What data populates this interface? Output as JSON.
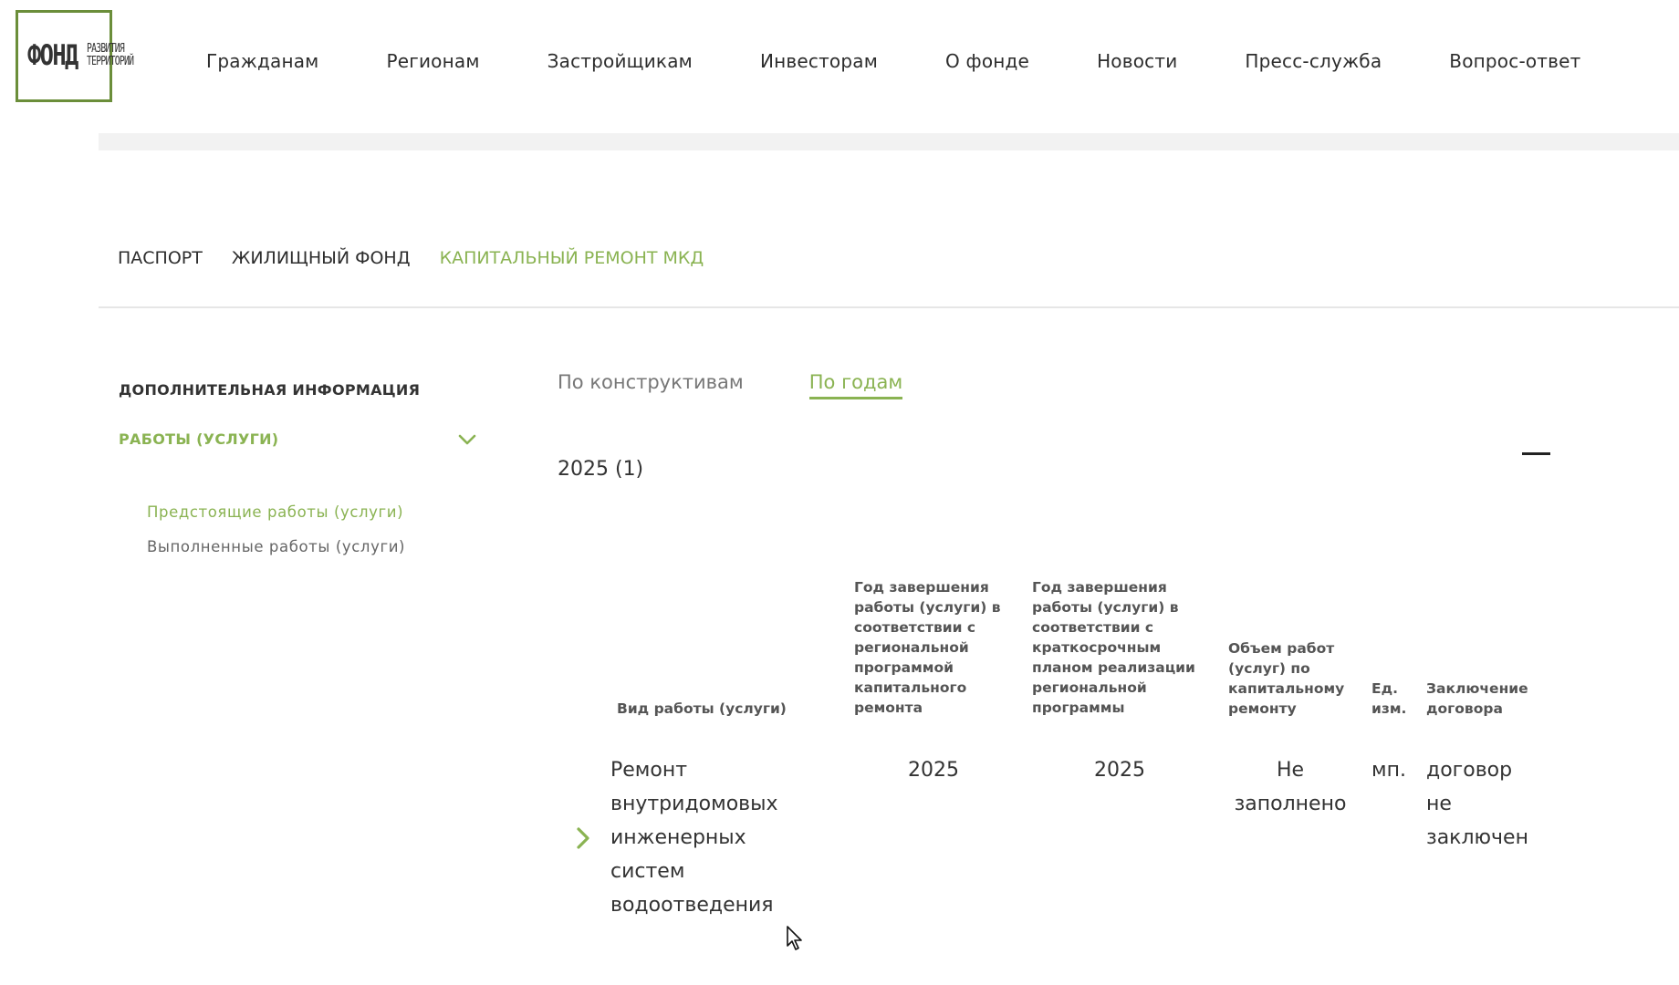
{
  "logo": {
    "main": "ФОНД",
    "sub_line1": "РАЗВИТИЯ",
    "sub_line2": "ТЕРРИТОРИЙ"
  },
  "nav": {
    "items": [
      "Гражданам",
      "Регионам",
      "Застройщикам",
      "Инвесторам",
      "О фонде",
      "Новости",
      "Пресс-служба",
      "Вопрос-ответ"
    ]
  },
  "section_tabs": [
    {
      "label": "ПАСПОРТ",
      "active": false
    },
    {
      "label": "ЖИЛИЩНЫЙ ФОНД",
      "active": false
    },
    {
      "label": "КАПИТАЛЬНЫЙ РЕМОНТ МКД",
      "active": true
    }
  ],
  "sidebar": {
    "title": "ДОПОЛНИТЕЛЬНАЯ ИНФОРМАЦИЯ",
    "works_label": "РАБОТЫ (УСЛУГИ)",
    "sub_items": [
      "Предстоящие работы (услуги)",
      "Выполненные работы (услуги)"
    ]
  },
  "view_tabs": [
    {
      "label": "По конструктивам",
      "active": false
    },
    {
      "label": "По годам",
      "active": true
    }
  ],
  "year_group": "2025 (1)",
  "table": {
    "headers": {
      "work_type": "Вид работы (услуги)",
      "year_regional": "Год завершения работы (услуги) в соответствии с региональной программой капитального ремонта",
      "year_short": "Год завершения работы (услуги) в соответствии с краткосрочным планом реализации региональной программы",
      "volume": "Объем работ (услуг) по капитальному ремонту",
      "unit": "Ед. изм.",
      "contract": "Заключение договора"
    },
    "rows": [
      {
        "work_type": "Ремонт внутридомовых инженерных систем водоотведения",
        "year_regional": "2025",
        "year_short": "2025",
        "volume": "Не заполнено",
        "unit": "мп.",
        "contract": "договор не заключен"
      }
    ]
  },
  "colors": {
    "accent": "#8ab352",
    "logo_border": "#6b8e3a",
    "text": "#2d2d2d",
    "muted": "#777777"
  },
  "icons": {
    "works_toggle": "chevron-down-icon",
    "row_expand": "chevron-right-icon",
    "collapse": "minus-icon",
    "cursor": "mouse-pointer-icon"
  }
}
